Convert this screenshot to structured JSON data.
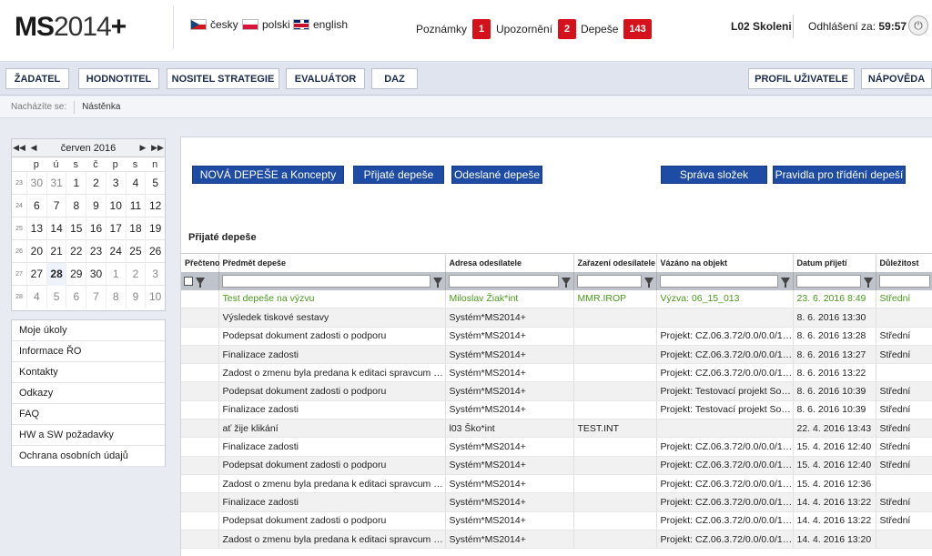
{
  "logo": {
    "part1": "MS",
    "part2": "2014",
    "part3": "+"
  },
  "languages": [
    {
      "label": "česky",
      "icon": "flag-cz-icon"
    },
    {
      "label": "polski",
      "icon": "flag-pl-icon"
    },
    {
      "label": "english",
      "icon": "flag-en-icon"
    }
  ],
  "header": {
    "notes_label": "Poznámky",
    "notes_count": "1",
    "alerts_label": "Upozornění",
    "alerts_count": "2",
    "messages_label": "Depeše",
    "messages_count": "143",
    "user": "L02 Skoleni",
    "logout_label": "Odhlášení za:",
    "logout_time": "59:57"
  },
  "nav": {
    "left": [
      "ŽADATEL",
      "HODNOTITEL",
      "NOSITEL STRATEGIE",
      "EVALUÁTOR",
      "DAZ"
    ],
    "right": [
      "PROFIL UŽIVATELE",
      "NÁPOVĚDA"
    ]
  },
  "breadcrumb": {
    "label": "Nacházíte se:",
    "current": "Nástěnka"
  },
  "calendar": {
    "month": "červen 2016",
    "nav": [
      "◀◀",
      "◀",
      "▶",
      "▶▶"
    ],
    "weekdays": [
      "p",
      "ú",
      "s",
      "č",
      "p",
      "s",
      "n"
    ],
    "weeks": [
      {
        "num": "23",
        "days": [
          "30",
          "31",
          "1",
          "2",
          "3",
          "4",
          "5"
        ]
      },
      {
        "num": "24",
        "days": [
          "6",
          "7",
          "8",
          "9",
          "10",
          "11",
          "12"
        ]
      },
      {
        "num": "25",
        "days": [
          "13",
          "14",
          "15",
          "16",
          "17",
          "18",
          "19"
        ]
      },
      {
        "num": "26",
        "days": [
          "20",
          "21",
          "22",
          "23",
          "24",
          "25",
          "26"
        ]
      },
      {
        "num": "27",
        "days": [
          "27",
          "28",
          "29",
          "30",
          "1",
          "2",
          "3"
        ]
      },
      {
        "num": "28",
        "days": [
          "4",
          "5",
          "6",
          "7",
          "8",
          "9",
          "10"
        ]
      }
    ],
    "today": "28"
  },
  "sidemenu": [
    "Moje úkoly",
    "Informace ŘO",
    "Kontakty",
    "Odkazy",
    "FAQ",
    "HW a SW požadavky",
    "Ochrana osobních údajů"
  ],
  "actions": {
    "new": "NOVÁ DEPEŠE a Koncepty",
    "received": "Přijaté depeše",
    "sent": "Odeslané depeše",
    "folders": "Správa složek",
    "rules": "Pravidla pro třídění depeší"
  },
  "section_title": "Přijaté depeše",
  "table": {
    "columns": [
      "Přečteno",
      "Předmět depeše",
      "Adresa odesílatele",
      "Zařazení odesílatele",
      "Vázáno na objekt",
      "Datum přijetí",
      "Důležitost"
    ],
    "rows": [
      {
        "unread": true,
        "subject": "Test depeše na výzvu",
        "sender": "Miloslav Žiak*int",
        "category": "MMR.IROP",
        "object": "Výzva: 06_15_013",
        "date": "23. 6. 2016 8:49",
        "priority": "Střední"
      },
      {
        "unread": false,
        "subject": "Výsledek tiskové sestavy",
        "sender": "Systém*MS2014+",
        "category": "",
        "object": "",
        "date": "8. 6. 2016 13:30",
        "priority": ""
      },
      {
        "unread": false,
        "subject": "Podepsat dokument zadosti o podporu",
        "sender": "Systém*MS2014+",
        "category": "",
        "object": "Projekt: CZ.06.3.72/0.0/0.0/15...",
        "date": "8. 6. 2016 13:28",
        "priority": "Střední"
      },
      {
        "unread": false,
        "subject": "Finalizace zadosti",
        "sender": "Systém*MS2014+",
        "category": "",
        "object": "Projekt: CZ.06.3.72/0.0/0.0/15...",
        "date": "8. 6. 2016 13:27",
        "priority": "Střední"
      },
      {
        "unread": false,
        "subject": "Zadost o zmenu byla predana k editaci spravcum proje...",
        "sender": "Systém*MS2014+",
        "category": "",
        "object": "Projekt: CZ.06.3.72/0.0/0.0/15...",
        "date": "8. 6. 2016 13:22",
        "priority": ""
      },
      {
        "unread": false,
        "subject": "Podepsat dokument zadosti o podporu",
        "sender": "Systém*MS2014+",
        "category": "",
        "object": "Projekt: Testovací projekt Sou...",
        "date": "8. 6. 2016 10:39",
        "priority": "Střední"
      },
      {
        "unread": false,
        "subject": "Finalizace zadosti",
        "sender": "Systém*MS2014+",
        "category": "",
        "object": "Projekt: Testovací projekt Sou...",
        "date": "8. 6. 2016 10:39",
        "priority": "Střední"
      },
      {
        "unread": false,
        "subject": "ať žije klikání",
        "sender": "l03 Ško*int",
        "category": "TEST.INT",
        "object": "",
        "date": "22. 4. 2016 13:43",
        "priority": "Střední"
      },
      {
        "unread": false,
        "subject": "Finalizace zadosti",
        "sender": "Systém*MS2014+",
        "category": "",
        "object": "Projekt: CZ.06.3.72/0.0/0.0/15...",
        "date": "15. 4. 2016 12:40",
        "priority": "Střední"
      },
      {
        "unread": false,
        "subject": "Podepsat dokument zadosti o podporu",
        "sender": "Systém*MS2014+",
        "category": "",
        "object": "Projekt: CZ.06.3.72/0.0/0.0/15...",
        "date": "15. 4. 2016 12:40",
        "priority": "Střední"
      },
      {
        "unread": false,
        "subject": "Zadost o zmenu byla predana k editaci spravcum proje...",
        "sender": "Systém*MS2014+",
        "category": "",
        "object": "Projekt: CZ.06.3.72/0.0/0.0/15...",
        "date": "15. 4. 2016 12:36",
        "priority": ""
      },
      {
        "unread": false,
        "subject": "Finalizace zadosti",
        "sender": "Systém*MS2014+",
        "category": "",
        "object": "Projekt: CZ.06.3.72/0.0/0.0/15...",
        "date": "14. 4. 2016 13:22",
        "priority": "Střední"
      },
      {
        "unread": false,
        "subject": "Podepsat dokument zadosti o podporu",
        "sender": "Systém*MS2014+",
        "category": "",
        "object": "Projekt: CZ.06.3.72/0.0/0.0/15...",
        "date": "14. 4. 2016 13:22",
        "priority": "Střední"
      },
      {
        "unread": false,
        "subject": "Zadost o zmenu byla predana k editaci spravcum proje...",
        "sender": "Systém*MS2014+",
        "category": "",
        "object": "Projekt: CZ.06.3.72/0.0/0.0/15...",
        "date": "14. 4. 2016 13:20",
        "priority": ""
      }
    ]
  },
  "colors": {
    "primary": "#1e4ba3",
    "badge": "#d5121b",
    "unread_text": "#4a9a1c"
  }
}
